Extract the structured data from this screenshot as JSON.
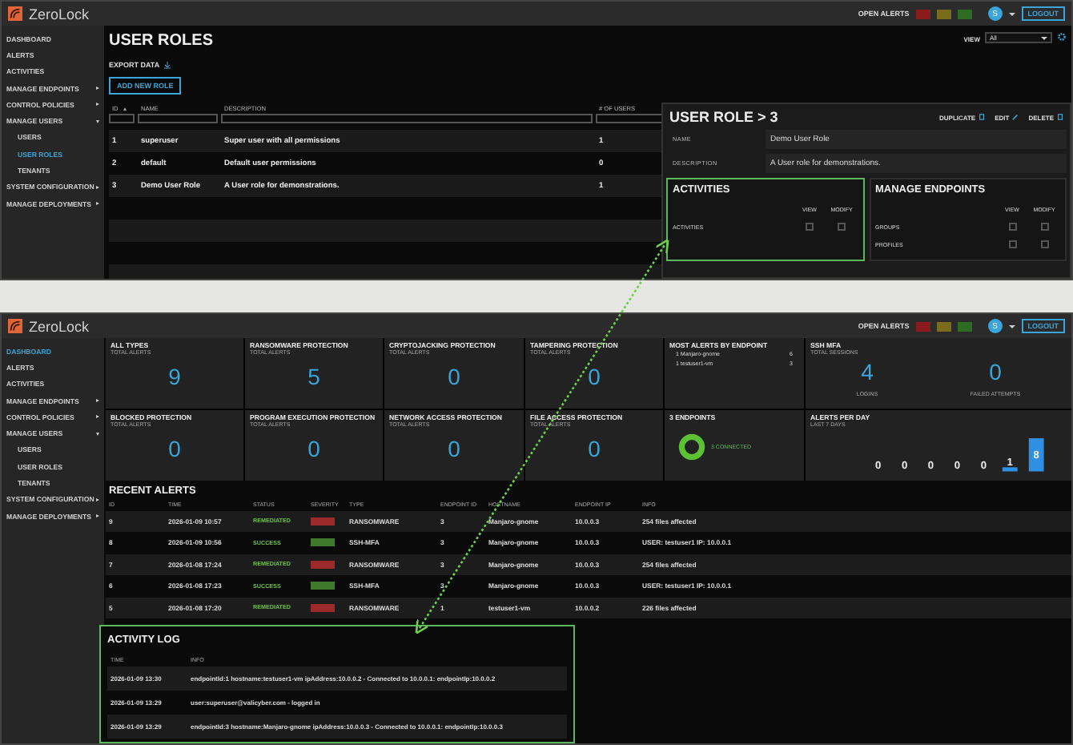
{
  "user_roles_screen": {
    "header": {
      "app_name": "ZeroLock",
      "open_alerts_label": "OPEN ALERTS",
      "alert_badges": [
        {
          "color": "#8a1c1c"
        },
        {
          "color": "#7a6a1c"
        },
        {
          "color": "#2f6b22"
        }
      ],
      "avatar": "S",
      "logout": "LOGOUT"
    },
    "sidebar": [
      {
        "label": "DASHBOARD",
        "selected": false
      },
      {
        "label": "ALERTS",
        "selected": false
      },
      {
        "label": "ACTIVITIES",
        "selected": false
      },
      {
        "label": "MANAGE ENDPOINTS",
        "selected": false,
        "expanded": false
      },
      {
        "label": "CONTROL POLICIES",
        "selected": false,
        "expanded": false
      },
      {
        "label": "MANAGE USERS",
        "selected": false,
        "expanded": true,
        "children": [
          {
            "label": "USERS",
            "selected": false
          },
          {
            "label": "USER ROLES",
            "selected": true
          },
          {
            "label": "TENANTS",
            "selected": false
          }
        ]
      },
      {
        "label": "SYSTEM CONFIGURATION",
        "selected": false,
        "expanded": false
      },
      {
        "label": "MANAGE DEPLOYMENTS",
        "selected": false,
        "expanded": false
      }
    ],
    "title": "USER ROLES",
    "export": "EXPORT DATA",
    "add_button": "ADD NEW ROLE",
    "view_label": "VIEW",
    "view_value": "All",
    "table": {
      "columns": [
        "ID",
        "NAME",
        "DESCRIPTION",
        "# OF USERS"
      ],
      "rows": [
        [
          "1",
          "superuser",
          "Super user with all permissions",
          "1"
        ],
        [
          "2",
          "default",
          "Default user permissions",
          "0"
        ],
        [
          "3",
          "Demo User Role",
          "A User role for demonstrations.",
          "1"
        ]
      ]
    },
    "detail": {
      "title": "USER ROLE > 3",
      "actions": [
        "DUPLICATE",
        "EDIT",
        "DELETE"
      ],
      "fields": [
        {
          "label": "NAME",
          "value": "Demo User Role"
        },
        {
          "label": "DESCRIPTION",
          "value": "A User role for demonstrations."
        }
      ],
      "cards": [
        {
          "title": "ACTIVITIES",
          "highlighted": true,
          "columns": [
            "VIEW",
            "MODIFY"
          ],
          "rows": [
            {
              "label": "ACTIVITIES",
              "view": false,
              "modify": false
            }
          ]
        },
        {
          "title": "MANAGE ENDPOINTS",
          "highlighted": false,
          "columns": [
            "VIEW",
            "MODIFY"
          ],
          "rows": [
            {
              "label": "GROUPS",
              "view": false,
              "modify": false
            },
            {
              "label": "PROFILES",
              "view": false,
              "modify": false
            }
          ]
        }
      ]
    }
  },
  "dashboard_screen": {
    "header": {
      "app_name": "ZeroLock",
      "open_alerts_label": "OPEN ALERTS",
      "alert_badges": [
        {
          "color": "#8a1c1c"
        },
        {
          "color": "#7a6a1c"
        },
        {
          "color": "#2f6b22"
        }
      ],
      "avatar": "S",
      "logout": "LOGOUT"
    },
    "sidebar": [
      {
        "label": "DASHBOARD",
        "selected": true
      },
      {
        "label": "ALERTS",
        "selected": false
      },
      {
        "label": "ACTIVITIES",
        "selected": false
      },
      {
        "label": "MANAGE ENDPOINTS",
        "selected": false,
        "expanded": false
      },
      {
        "label": "CONTROL POLICIES",
        "selected": false,
        "expanded": false
      },
      {
        "label": "MANAGE USERS",
        "selected": false,
        "expanded": true,
        "children": [
          {
            "label": "USERS",
            "selected": false
          },
          {
            "label": "USER ROLES",
            "selected": false
          },
          {
            "label": "TENANTS",
            "selected": false
          }
        ]
      },
      {
        "label": "SYSTEM CONFIGURATION",
        "selected": false,
        "expanded": false
      },
      {
        "label": "MANAGE DEPLOYMENTS",
        "selected": false,
        "expanded": false
      }
    ],
    "cards": [
      {
        "kind": "stat",
        "title": "ALL TYPES",
        "subtitle": "TOTAL ALERTS",
        "value": "9"
      },
      {
        "kind": "stat",
        "title": "RANSOMWARE PROTECTION",
        "subtitle": "TOTAL ALERTS",
        "value": "5"
      },
      {
        "kind": "stat",
        "title": "CRYPTOJACKING PROTECTION",
        "subtitle": "TOTAL ALERTS",
        "value": "0"
      },
      {
        "kind": "stat",
        "title": "TAMPERING PROTECTION",
        "subtitle": "TOTAL ALERTS",
        "value": "0"
      },
      {
        "kind": "ranking",
        "title": "MOST ALERTS BY ENDPOINT",
        "items": [
          {
            "name": "1 Manjaro-gnome",
            "count": "6"
          },
          {
            "name": "1 testuser1-vm",
            "count": "3"
          }
        ]
      },
      {
        "kind": "mfa",
        "title": "SSH MFA",
        "subtitle": "TOTAL SESSIONS",
        "metrics": [
          {
            "value": "4",
            "label": "LOGINS"
          },
          {
            "value": "0",
            "label": "FAILED ATTEMPTS"
          }
        ]
      },
      {
        "kind": "stat",
        "title": "BLOCKED PROTECTION",
        "subtitle": "TOTAL ALERTS",
        "value": "0"
      },
      {
        "kind": "stat",
        "title": "PROGRAM EXECUTION PROTECTION",
        "subtitle": "TOTAL ALERTS",
        "value": "0"
      },
      {
        "kind": "stat",
        "title": "NETWORK ACCESS PROTECTION",
        "subtitle": "TOTAL ALERTS",
        "value": "0"
      },
      {
        "kind": "stat",
        "title": "FILE ACCESS PROTECTION",
        "subtitle": "TOTAL ALERTS",
        "value": "0"
      },
      {
        "kind": "endpoints",
        "title": "3 ENDPOINTS",
        "legend": "3 CONNECTED"
      },
      {
        "kind": "chart",
        "title": "ALERTS PER DAY",
        "subtitle": "LAST 7 DAYS",
        "day_counts": [
          "0",
          "0",
          "0",
          "0",
          "0",
          "1",
          "8"
        ]
      }
    ],
    "recent_alerts": {
      "title": "RECENT ALERTS",
      "columns": [
        "ID",
        "TIME",
        "STATUS",
        "SEVERITY",
        "TYPE",
        "ENDPOINT ID",
        "HOSTNAME",
        "ENDPOINT IP",
        "INFO"
      ],
      "rows": [
        {
          "id": "9",
          "time": "2026-01-09 10:57",
          "status": "REMEDIATED",
          "color": "#9c2a2a",
          "type": "RANSOMWARE",
          "endpoint_id": "3",
          "hostname": "Manjaro-gnome",
          "ip": "10.0.0.3",
          "info": "254 files affected"
        },
        {
          "id": "8",
          "time": "2026-01-09 10:56",
          "status": "SUCCESS",
          "color": "#3f7a2c",
          "type": "SSH-MFA",
          "endpoint_id": "3",
          "hostname": "Manjaro-gnome",
          "ip": "10.0.0.3",
          "info": "USER: testuser1 IP: 10.0.0.1"
        },
        {
          "id": "7",
          "time": "2026-01-08 17:24",
          "status": "REMEDIATED",
          "color": "#9c2a2a",
          "type": "RANSOMWARE",
          "endpoint_id": "3",
          "hostname": "Manjaro-gnome",
          "ip": "10.0.0.3",
          "info": "254 files affected"
        },
        {
          "id": "6",
          "time": "2026-01-08 17:23",
          "status": "SUCCESS",
          "color": "#3f7a2c",
          "type": "SSH-MFA",
          "endpoint_id": "3",
          "hostname": "Manjaro-gnome",
          "ip": "10.0.0.3",
          "info": "USER: testuser1 IP: 10.0.0.1"
        },
        {
          "id": "5",
          "time": "2026-01-08 17:20",
          "status": "REMEDIATED",
          "color": "#9c2a2a",
          "type": "RANSOMWARE",
          "endpoint_id": "1",
          "hostname": "testuser1-vm",
          "ip": "10.0.0.2",
          "info": "226 files affected"
        }
      ]
    },
    "activity_log": {
      "title": "ACTIVITY LOG",
      "highlighted": true,
      "columns": [
        "TIME",
        "INFO"
      ],
      "rows": [
        {
          "time": "2026-01-09 13:30",
          "info": "endpointId:1 hostname:testuser1-vm ipAddress:10.0.0.2 - Connected to 10.0.0.1: endpointIp:10.0.0.2"
        },
        {
          "time": "2026-01-09 13:29",
          "info": "user:superuser@valicyber.com - logged in"
        },
        {
          "time": "2026-01-09 13:29",
          "info": "endpointId:3 hostname:Manjaro-gnome ipAddress:10.0.0.3 - Connected to 10.0.0.1: endpointIp:10.0.0.3"
        }
      ]
    }
  }
}
